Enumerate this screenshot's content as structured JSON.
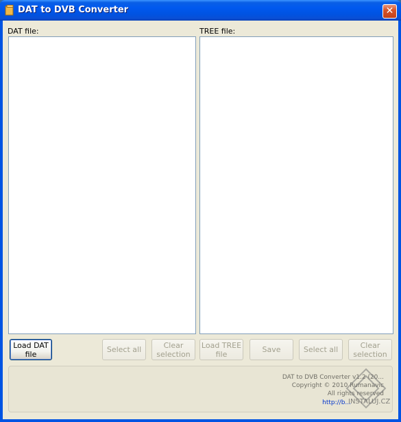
{
  "window": {
    "title": "DAT to DVB Converter",
    "close_glyph": "✕"
  },
  "dat_panel": {
    "label": "DAT file:"
  },
  "tree_panel": {
    "label": "TREE file:"
  },
  "buttons": {
    "load_dat": "Load DAT file",
    "select_all_dat": "Select all",
    "clear_selection_dat": "Clear selection",
    "load_tree": "Load TREE file",
    "save": "Save",
    "select_all_tree": "Select all",
    "clear_selection_tree": "Clear selection"
  },
  "info": {
    "version_line": "DAT to DVB Converter v1.2 (20...",
    "copyright_line": "Copyright © 2010 Rumanavic",
    "rights_line": "All rights reserved",
    "link": "http://b..."
  },
  "watermark": {
    "text": "INSTALUJ.CZ"
  },
  "colors": {
    "titlebar": "#0058ee",
    "client_bg": "#ece9d8",
    "list_border": "#7f9db9",
    "disabled_text": "#a2a08e",
    "link": "#0033cc"
  }
}
